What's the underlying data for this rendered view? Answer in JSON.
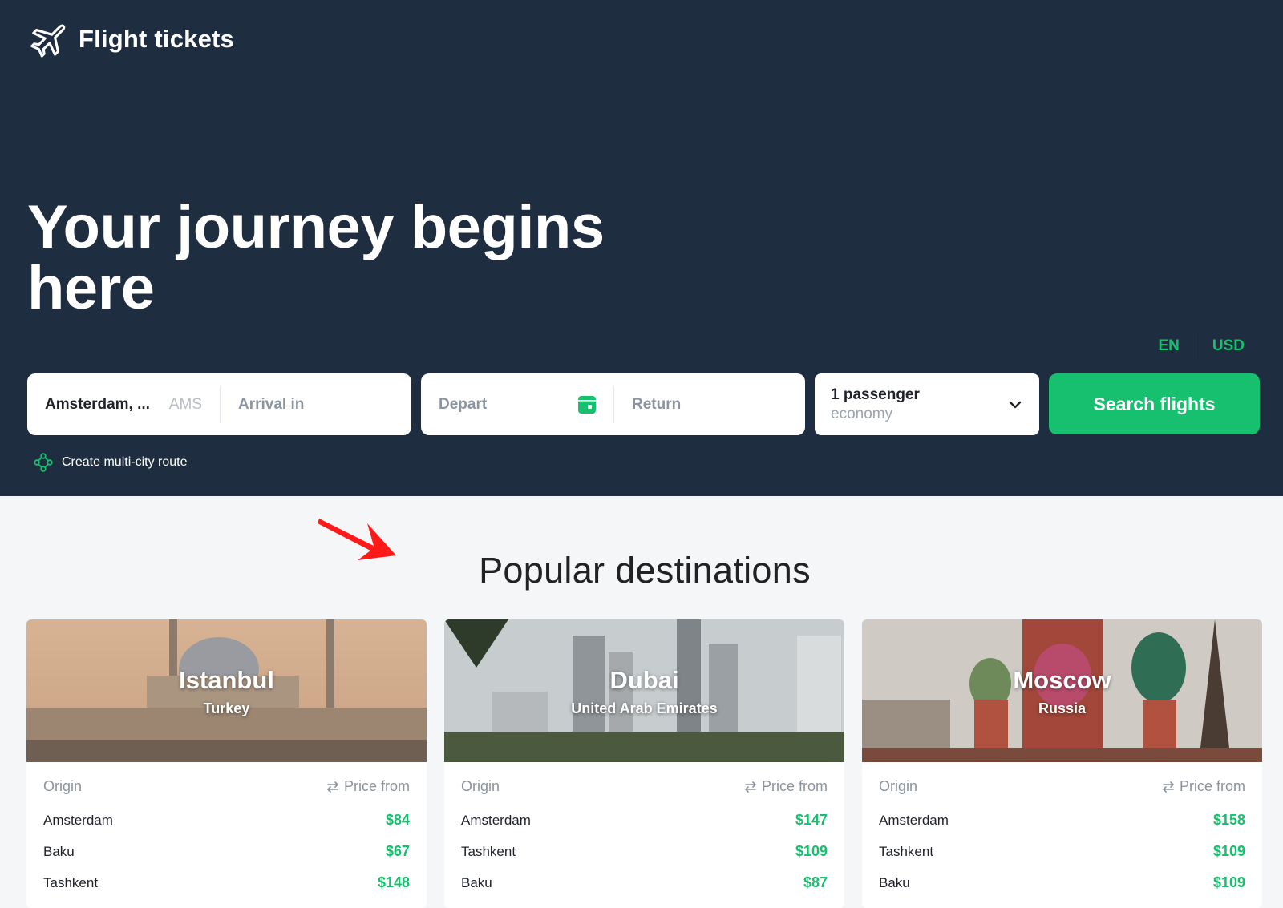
{
  "app": {
    "title": "Flight tickets",
    "logo_icon": "airplane-icon"
  },
  "hero": {
    "headline": "Your journey begins here"
  },
  "locale": {
    "language": "EN",
    "currency": "USD"
  },
  "search": {
    "origin_value": "Amsterdam, ...",
    "origin_code": "AMS",
    "arrival_placeholder": "Arrival in",
    "depart_placeholder": "Depart",
    "return_placeholder": "Return",
    "passengers": "1 passenger",
    "cabin_class": "economy",
    "button_label": "Search flights"
  },
  "multicity": {
    "label": "Create multi-city route"
  },
  "popular": {
    "title": "Popular destinations",
    "origin_header": "Origin",
    "price_header": "Price from",
    "cards": [
      {
        "city": "Istanbul",
        "country": "Turkey",
        "rows": [
          {
            "origin": "Amsterdam",
            "price": "$84"
          },
          {
            "origin": "Baku",
            "price": "$67"
          },
          {
            "origin": "Tashkent",
            "price": "$148"
          }
        ]
      },
      {
        "city": "Dubai",
        "country": "United Arab Emirates",
        "rows": [
          {
            "origin": "Amsterdam",
            "price": "$147"
          },
          {
            "origin": "Tashkent",
            "price": "$109"
          },
          {
            "origin": "Baku",
            "price": "$87"
          }
        ]
      },
      {
        "city": "Moscow",
        "country": "Russia",
        "rows": [
          {
            "origin": "Amsterdam",
            "price": "$158"
          },
          {
            "origin": "Tashkent",
            "price": "$109"
          },
          {
            "origin": "Baku",
            "price": "$109"
          }
        ]
      }
    ]
  },
  "colors": {
    "hero_bg": "#1e2d3f",
    "accent_green": "#16c06e",
    "page_bg": "#f5f6f8",
    "annotation_arrow": "#ff1a1a"
  }
}
